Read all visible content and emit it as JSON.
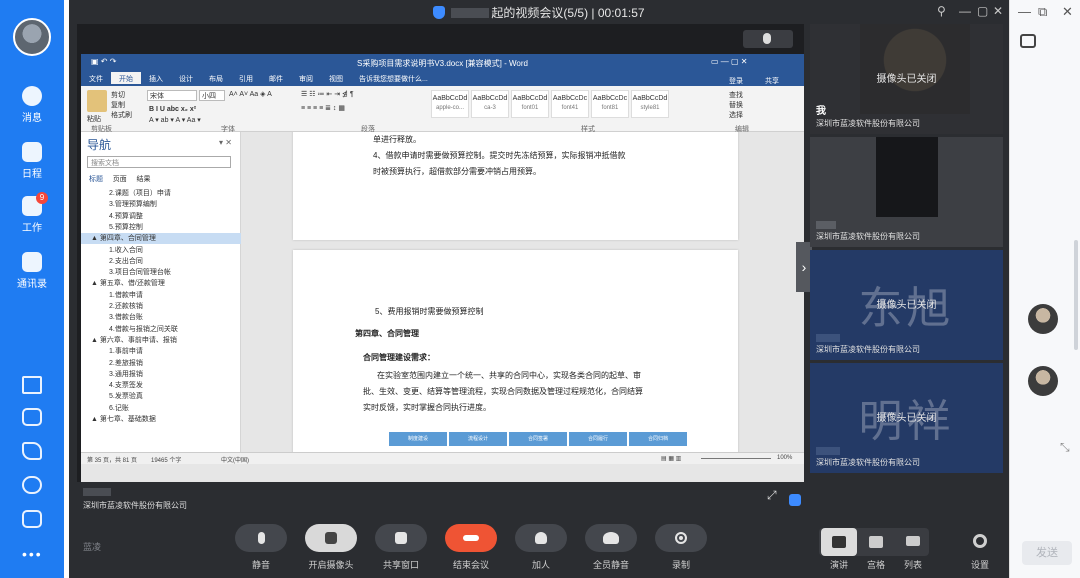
{
  "app": {
    "meeting_title": "起的视频会议(5/5) | 00:01:57"
  },
  "sidebar": {
    "items": [
      {
        "label": "消息",
        "icon": "message-icon"
      },
      {
        "label": "日程",
        "icon": "calendar-icon"
      },
      {
        "label": "工作",
        "icon": "apps-icon",
        "badge": "9"
      },
      {
        "label": "通讯录",
        "icon": "contacts-icon"
      }
    ],
    "tools": [
      "lightning-icon",
      "box-icon",
      "phone-icon",
      "cloud-icon",
      "mail-icon",
      "more-icon"
    ]
  },
  "word": {
    "title": "S采购项目需求说明书V3.docx [兼容模式] - Word",
    "tabs": [
      "文件",
      "开始",
      "插入",
      "设计",
      "布局",
      "引用",
      "邮件",
      "审阅",
      "视图",
      "告诉我您想要做什么..."
    ],
    "account": "登录",
    "share": "共享",
    "font_name": "宋体",
    "font_size": "小四",
    "groups": [
      "剪贴板",
      "字体",
      "段落",
      "样式",
      "编辑"
    ],
    "clipboard": [
      "粘贴",
      "剪切",
      "复制",
      "格式刷"
    ],
    "styles": [
      {
        "sample": "AaBbCcDd",
        "name": "apple-co..."
      },
      {
        "sample": "AaBbCcDd",
        "name": "ca-3"
      },
      {
        "sample": "AaBbCcDd",
        "name": "font01"
      },
      {
        "sample": "AaBbCcDc",
        "name": "font41"
      },
      {
        "sample": "AaBbCcDc",
        "name": "font81"
      },
      {
        "sample": "AaBbCcDd",
        "name": "style81"
      }
    ],
    "editing": [
      "查找",
      "替换",
      "选择"
    ],
    "nav": {
      "title": "导航",
      "search_placeholder": "搜索文档",
      "tabs": [
        "标题",
        "页面",
        "结果"
      ],
      "tree": [
        {
          "text": "2.课题（项目）申请",
          "level": 2
        },
        {
          "text": "3.管理预算编制",
          "level": 2
        },
        {
          "text": "4.预算调整",
          "level": 2
        },
        {
          "text": "5.预算控制",
          "level": 2
        },
        {
          "text": "▲ 第四章、合同管理",
          "level": 1,
          "selected": true
        },
        {
          "text": "1.收入合同",
          "level": 2
        },
        {
          "text": "2.支出合同",
          "level": 2
        },
        {
          "text": "3.项目合同管理台帐",
          "level": 2
        },
        {
          "text": "▲ 第五章、借/还款管理",
          "level": 1
        },
        {
          "text": "1.借款申请",
          "level": 2
        },
        {
          "text": "2.还款核销",
          "level": 2
        },
        {
          "text": "3.借款台账",
          "level": 2
        },
        {
          "text": "4.借款与报销之间关联",
          "level": 2
        },
        {
          "text": "▲ 第六章、事前申请、报销",
          "level": 1
        },
        {
          "text": "1.事前申请",
          "level": 2
        },
        {
          "text": "2.差旅报销",
          "level": 2
        },
        {
          "text": "3.通用报销",
          "level": 2
        },
        {
          "text": "4.支票签发",
          "level": 2
        },
        {
          "text": "5.发票验真",
          "level": 2
        },
        {
          "text": "6.记账",
          "level": 2
        },
        {
          "text": "▲ 第七章、基础数据",
          "level": 1
        }
      ]
    },
    "page1": {
      "lines": [
        "单进行释放。",
        "4、借款申请时需要做预算控制。提交时先冻结预算，实际报销冲抵借款",
        "时被预算执行，超借款部分需要冲销占用预算。"
      ]
    },
    "page2": {
      "item5": "5、费用报销时需要做预算控制",
      "chapter": "第四章、合同管理",
      "subheading": "合同管理建设需求：",
      "paragraph": [
        "在实验室范围内建立一个统一、共享的合同中心，实现各类合同的起草、审",
        "批、生效、变更、结算等管理流程，实现合同数据及管理过程规范化，合同结算",
        "实时反馈，实时掌握合同执行进度。"
      ],
      "flow": [
        "制度建设",
        "流程设计",
        "合同签署",
        "合同履行",
        "合同归档"
      ]
    },
    "status": {
      "page": "第 35 页，共 81 页",
      "words": "19465 个字",
      "lang": "中文(中国)",
      "zoom": "100%"
    }
  },
  "sharer": {
    "company": "深圳市蓝凌软件股份有限公司"
  },
  "participants": [
    {
      "name": "我",
      "status": "摄像头已关闭",
      "company": "深圳市蓝凌软件股份有限公司",
      "watermark": ""
    },
    {
      "name": "",
      "status": "",
      "company": "深圳市蓝凌软件股份有限公司",
      "watermark": ""
    },
    {
      "name": "",
      "status": "摄像头已关闭",
      "company": "深圳市蓝凌软件股份有限公司",
      "watermark": "东旭"
    },
    {
      "name": "",
      "status": "摄像头已关闭",
      "company": "深圳市蓝凌软件股份有限公司",
      "watermark": "明祥"
    }
  ],
  "toolbar": {
    "brand": "蓝凌",
    "buttons": [
      {
        "label": "静音",
        "icon": "microphone-icon"
      },
      {
        "label": "开启摄像头",
        "icon": "camera-off-icon"
      },
      {
        "label": "共享窗口",
        "icon": "share-screen-icon"
      },
      {
        "label": "结束会议",
        "icon": "hang-up-icon"
      },
      {
        "label": "加人",
        "icon": "add-person-icon"
      },
      {
        "label": "全员静音",
        "icon": "mute-all-icon"
      },
      {
        "label": "录制",
        "icon": "record-icon"
      }
    ],
    "layouts": [
      {
        "label": "演讲",
        "icon": "speaker-layout-icon"
      },
      {
        "label": "宫格",
        "icon": "grid-layout-icon"
      },
      {
        "label": "列表",
        "icon": "list-layout-icon"
      }
    ],
    "settings_label": "设置"
  },
  "rightpanel": {
    "send_label": "发送"
  },
  "colors": {
    "sidebar": "#1f7cf2",
    "end_call": "#ef5434",
    "word_blue": "#2b5797"
  }
}
